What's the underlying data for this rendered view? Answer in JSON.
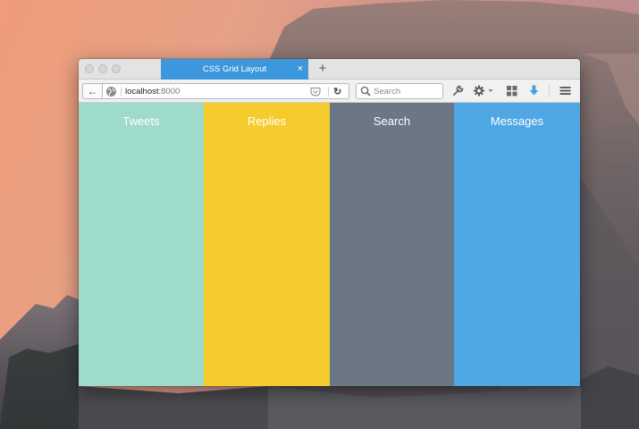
{
  "browser": {
    "tab": {
      "title": "CSS Grid Layout",
      "close_glyph": "×",
      "accent_color": "#3d97dc"
    },
    "new_tab_glyph": "+",
    "url": {
      "host": "localhost",
      "port": ":8000"
    },
    "search": {
      "placeholder": "Search"
    },
    "nav": {
      "back_glyph": "←",
      "reload_glyph": "↻"
    },
    "toolbar_icons": [
      "wrench-icon",
      "gear-icon",
      "grid-icon",
      "download-icon",
      "menu-icon"
    ]
  },
  "columns": [
    {
      "label": "Tweets",
      "color": "#9fdbcb"
    },
    {
      "label": "Replies",
      "color": "#f5cb2e"
    },
    {
      "label": "Search",
      "color": "#6b7784"
    },
    {
      "label": "Messages",
      "color": "#4fa8e3"
    }
  ]
}
